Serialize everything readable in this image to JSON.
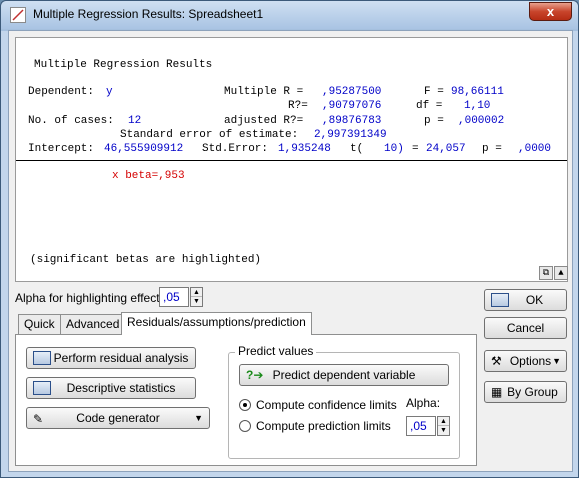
{
  "window": {
    "title": "Multiple Regression Results: Spreadsheet1",
    "close_label": "x"
  },
  "results": {
    "heading": "Multiple Regression Results",
    "dependent_label": "Dependent:",
    "dependent_value": "y",
    "multiple_r_label": "Multiple R =",
    "multiple_r_value": ",95287500",
    "f_label": "F =",
    "f_value": "98,66111",
    "r2_label": "R?=",
    "r2_value": ",90797076",
    "df_label": "df =",
    "df_value": "1,10",
    "cases_label": "No. of cases:",
    "cases_value": "12",
    "adj_r2_label": "adjusted R?=",
    "adj_r2_value": ",89876783",
    "p_label": "p =",
    "p_value": ",000002",
    "std_err_est_label": "Standard error of estimate:",
    "std_err_est_value": "2,997391349",
    "intercept_label": "Intercept:",
    "intercept_value": "46,555909912",
    "std_error_label": "Std.Error:",
    "std_error_value": "1,935248",
    "t_label": "t(",
    "t_df": "10)",
    "t_eq": "=",
    "t_value": "24,057",
    "p2_label": "p =",
    "p2_value": ",0000",
    "beta_line": "x beta=,953",
    "footer_note": "(significant betas are highlighted)"
  },
  "alpha": {
    "label": "Alpha for highlighting effects:",
    "value": ",05"
  },
  "tabs": [
    {
      "label": "Quick"
    },
    {
      "label": "Advanced"
    },
    {
      "label": "Residuals/assumptions/prediction"
    }
  ],
  "panel": {
    "perform_residual": "Perform residual analysis",
    "descriptive": "Descriptive statistics",
    "code_generator": "Code generator",
    "predict_group": "Predict values",
    "predict_dependent": "Predict dependent variable",
    "confidence": "Compute confidence limits",
    "prediction": "Compute prediction limits",
    "alpha_label": "Alpha:",
    "alpha_value": ",05"
  },
  "side": {
    "ok": "OK",
    "cancel": "Cancel",
    "options": "Options",
    "by_group": "By Group"
  },
  "colors": {
    "value_blue": "#0000c8",
    "beta_red": "#d40000"
  }
}
